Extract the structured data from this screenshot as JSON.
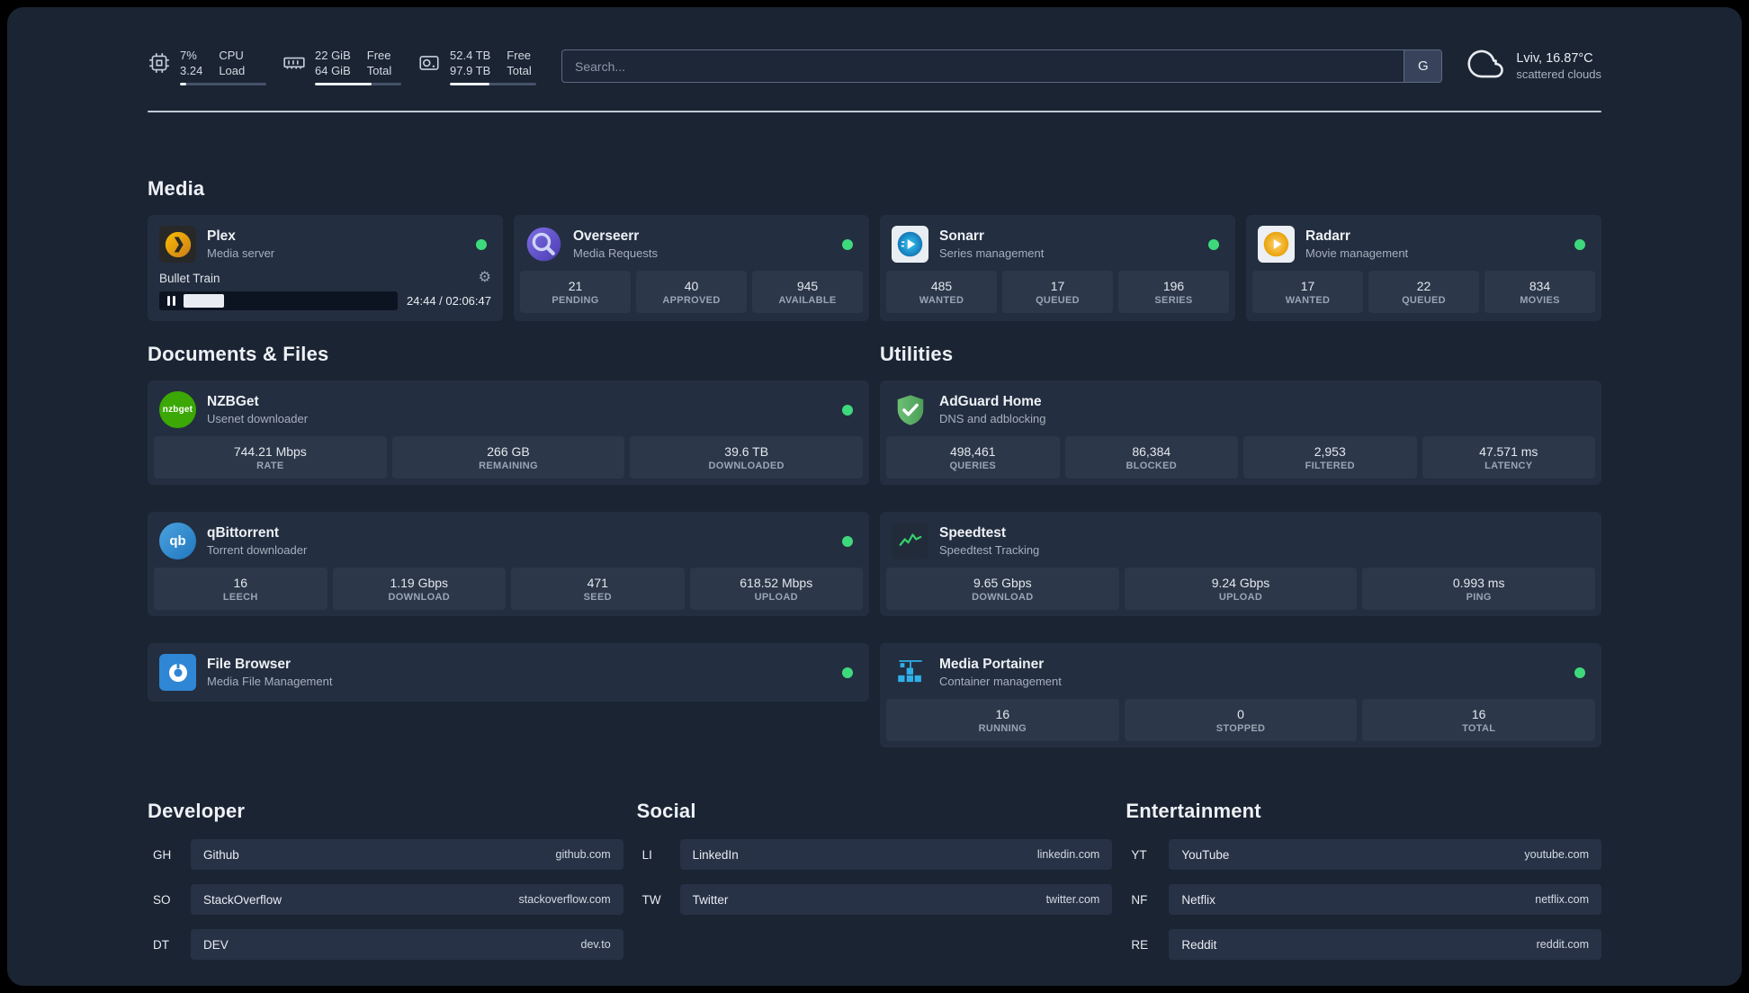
{
  "colors": {
    "status_online": "#3ed97c",
    "accent_green": "#35d06a",
    "background": "#1a2433"
  },
  "topbar": {
    "resources": [
      {
        "icon": "cpu-icon",
        "values": [
          "7%",
          "3.24"
        ],
        "labels": [
          "CPU",
          "Load"
        ],
        "percent": 7
      },
      {
        "icon": "memory-icon",
        "values": [
          "22 GiB",
          "64 GiB"
        ],
        "labels": [
          "Free",
          "Total"
        ],
        "percent": 66
      },
      {
        "icon": "disk-icon",
        "values": [
          "52.4 TB",
          "97.9 TB"
        ],
        "labels": [
          "Free",
          "Total"
        ],
        "percent": 46
      }
    ],
    "search": {
      "placeholder": "Search...",
      "provider_label": "G"
    },
    "weather": {
      "location": "Lviv, 16.87°C",
      "condition": "scattered clouds"
    }
  },
  "media": {
    "title": "Media",
    "plex": {
      "name": "Plex",
      "desc": "Media server",
      "now_playing": "Bullet Train",
      "time": "24:44 / 02:06:47",
      "progress_percent": 19
    },
    "cards": [
      {
        "name": "Overseerr",
        "desc": "Media Requests",
        "stats": [
          {
            "value": "21",
            "label": "PENDING"
          },
          {
            "value": "40",
            "label": "APPROVED"
          },
          {
            "value": "945",
            "label": "AVAILABLE"
          }
        ]
      },
      {
        "name": "Sonarr",
        "desc": "Series management",
        "stats": [
          {
            "value": "485",
            "label": "WANTED"
          },
          {
            "value": "17",
            "label": "QUEUED"
          },
          {
            "value": "196",
            "label": "SERIES"
          }
        ]
      },
      {
        "name": "Radarr",
        "desc": "Movie management",
        "stats": [
          {
            "value": "17",
            "label": "WANTED"
          },
          {
            "value": "22",
            "label": "QUEUED"
          },
          {
            "value": "834",
            "label": "MOVIES"
          }
        ]
      }
    ]
  },
  "documents": {
    "title": "Documents & Files",
    "cards": [
      {
        "name": "NZBGet",
        "desc": "Usenet downloader",
        "icon_text": "nzbget",
        "stats": [
          {
            "value": "744.21 Mbps",
            "label": "RATE"
          },
          {
            "value": "266 GB",
            "label": "REMAINING"
          },
          {
            "value": "39.6 TB",
            "label": "DOWNLOADED"
          }
        ]
      },
      {
        "name": "qBittorrent",
        "desc": "Torrent downloader",
        "icon_text": "qb",
        "stats": [
          {
            "value": "16",
            "label": "LEECH"
          },
          {
            "value": "1.19 Gbps",
            "label": "DOWNLOAD"
          },
          {
            "value": "471",
            "label": "SEED"
          },
          {
            "value": "618.52 Mbps",
            "label": "UPLOAD"
          }
        ]
      },
      {
        "name": "File Browser",
        "desc": "Media File Management",
        "stats": []
      }
    ]
  },
  "utilities": {
    "title": "Utilities",
    "cards": [
      {
        "name": "AdGuard Home",
        "desc": "DNS and adblocking",
        "stats": [
          {
            "value": "498,461",
            "label": "QUERIES"
          },
          {
            "value": "86,384",
            "label": "BLOCKED"
          },
          {
            "value": "2,953",
            "label": "FILTERED"
          },
          {
            "value": "47.571 ms",
            "label": "LATENCY"
          }
        ]
      },
      {
        "name": "Speedtest",
        "desc": "Speedtest Tracking",
        "stats": [
          {
            "value": "9.65 Gbps",
            "label": "DOWNLOAD"
          },
          {
            "value": "9.24 Gbps",
            "label": "UPLOAD"
          },
          {
            "value": "0.993 ms",
            "label": "PING"
          }
        ]
      },
      {
        "name": "Media Portainer",
        "desc": "Container management",
        "stats": [
          {
            "value": "16",
            "label": "RUNNING"
          },
          {
            "value": "0",
            "label": "STOPPED"
          },
          {
            "value": "16",
            "label": "TOTAL"
          }
        ]
      }
    ]
  },
  "bookmarks": [
    {
      "title": "Developer",
      "items": [
        {
          "abbr": "GH",
          "name": "Github",
          "domain": "github.com"
        },
        {
          "abbr": "SO",
          "name": "StackOverflow",
          "domain": "stackoverflow.com"
        },
        {
          "abbr": "DT",
          "name": "DEV",
          "domain": "dev.to"
        }
      ]
    },
    {
      "title": "Social",
      "items": [
        {
          "abbr": "LI",
          "name": "LinkedIn",
          "domain": "linkedin.com"
        },
        {
          "abbr": "TW",
          "name": "Twitter",
          "domain": "twitter.com"
        }
      ]
    },
    {
      "title": "Entertainment",
      "items": [
        {
          "abbr": "YT",
          "name": "YouTube",
          "domain": "youtube.com"
        },
        {
          "abbr": "NF",
          "name": "Netflix",
          "domain": "netflix.com"
        },
        {
          "abbr": "RE",
          "name": "Reddit",
          "domain": "reddit.com"
        }
      ]
    }
  ]
}
